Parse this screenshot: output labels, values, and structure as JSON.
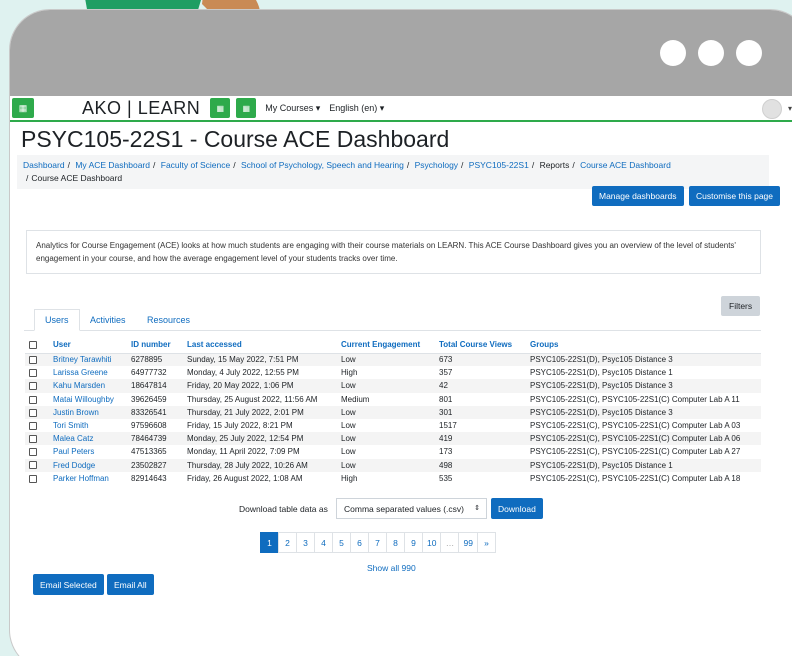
{
  "window": {
    "controls": [
      "dot-1",
      "dot-2",
      "dot-3"
    ]
  },
  "navbar": {
    "brand": "AKO | LEARN",
    "menu_icon": "grid-icon",
    "links": [
      {
        "label": "My Courses ▾"
      },
      {
        "label": "English (en) ▾"
      }
    ],
    "user_menu_caret": "▾"
  },
  "page": {
    "title": "PSYC105-22S1 - Course ACE Dashboard"
  },
  "breadcrumb": {
    "items": [
      {
        "label": "Dashboard",
        "link": true
      },
      {
        "label": "My ACE Dashboard",
        "link": true
      },
      {
        "label": "Faculty of Science",
        "link": true
      },
      {
        "label": "School of Psychology, Speech and Hearing",
        "link": true
      },
      {
        "label": "Psychology",
        "link": true
      },
      {
        "label": "PSYC105-22S1",
        "link": true
      },
      {
        "label": "Reports",
        "link": false
      },
      {
        "label": "Course ACE Dashboard",
        "link": true
      },
      {
        "label": "Course ACE Dashboard",
        "link": false
      }
    ],
    "separator": "/"
  },
  "actions": {
    "manage_label": "Manage dashboards",
    "customise_label": "Customise this page"
  },
  "intro": {
    "text": "Analytics for Course Engagement (ACE) looks at how much students are engaging with their course materials on LEARN. This ACE Course Dashboard gives you an overview of the level of students' engagement in your course, and how the average engagement level of your students tracks over time."
  },
  "tabs": [
    {
      "label": "Users",
      "active": true
    },
    {
      "label": "Activities",
      "active": false
    },
    {
      "label": "Resources",
      "active": false
    }
  ],
  "filters_label": "Filters",
  "table": {
    "columns": [
      "User",
      "ID number",
      "Last accessed",
      "Current Engagement",
      "Total Course Views",
      "Groups"
    ],
    "rows": [
      [
        "Britney Tarawhiti",
        "6278895",
        "Sunday, 15 May 2022, 7:51 PM",
        "Low",
        "673",
        "PSYC105-22S1(D), Psyc105 Distance 3"
      ],
      [
        "Larissa Greene",
        "64977732",
        "Monday, 4 July 2022, 12:55 PM",
        "High",
        "357",
        "PSYC105-22S1(D), Psyc105 Distance 1"
      ],
      [
        "Kahu Marsden",
        "18647814",
        "Friday, 20 May 2022, 1:06 PM",
        "Low",
        "42",
        "PSYC105-22S1(D), Psyc105 Distance 3"
      ],
      [
        "Matai Willoughby",
        "39626459",
        "Thursday, 25 August 2022, 11:56 AM",
        "Medium",
        "801",
        "PSYC105-22S1(C), PSYC105-22S1(C) Computer Lab A 11"
      ],
      [
        "Justin Brown",
        "83326541",
        "Thursday, 21 July 2022, 2:01 PM",
        "Low",
        "301",
        "PSYC105-22S1(D), Psyc105 Distance 3"
      ],
      [
        "Tori Smith",
        "97596608",
        "Friday, 15 July 2022, 8:21 PM",
        "Low",
        "1517",
        "PSYC105-22S1(C), PSYC105-22S1(C) Computer Lab A 03"
      ],
      [
        "Malea Catz",
        "78464739",
        "Monday, 25 July 2022, 12:54 PM",
        "Low",
        "419",
        "PSYC105-22S1(C), PSYC105-22S1(C) Computer Lab A 06"
      ],
      [
        "Paul Peters",
        "47513365",
        "Monday, 11 April 2022, 7:09 PM",
        "Low",
        "173",
        "PSYC105-22S1(C), PSYC105-22S1(C) Computer Lab A 27"
      ],
      [
        "Fred Dodge",
        "23502827",
        "Thursday, 28 July 2022, 10:26 AM",
        "Low",
        "498",
        "PSYC105-22S1(D), Psyc105 Distance 1"
      ],
      [
        "Parker Hoffman",
        "82914643",
        "Friday, 26 August 2022, 1:08 AM",
        "High",
        "535",
        "PSYC105-22S1(C), PSYC105-22S1(C) Computer Lab A 18"
      ]
    ]
  },
  "download": {
    "label": "Download table data as",
    "format": "Comma separated values (.csv)",
    "button": "Download"
  },
  "pagination": {
    "pages": [
      "1",
      "2",
      "3",
      "4",
      "5",
      "6",
      "7",
      "8",
      "9",
      "10",
      "…",
      "99",
      "»"
    ],
    "current": "1"
  },
  "show_all": "Show all 990",
  "bulk": {
    "email_selected": "Email Selected",
    "email_all": "Email All"
  }
}
